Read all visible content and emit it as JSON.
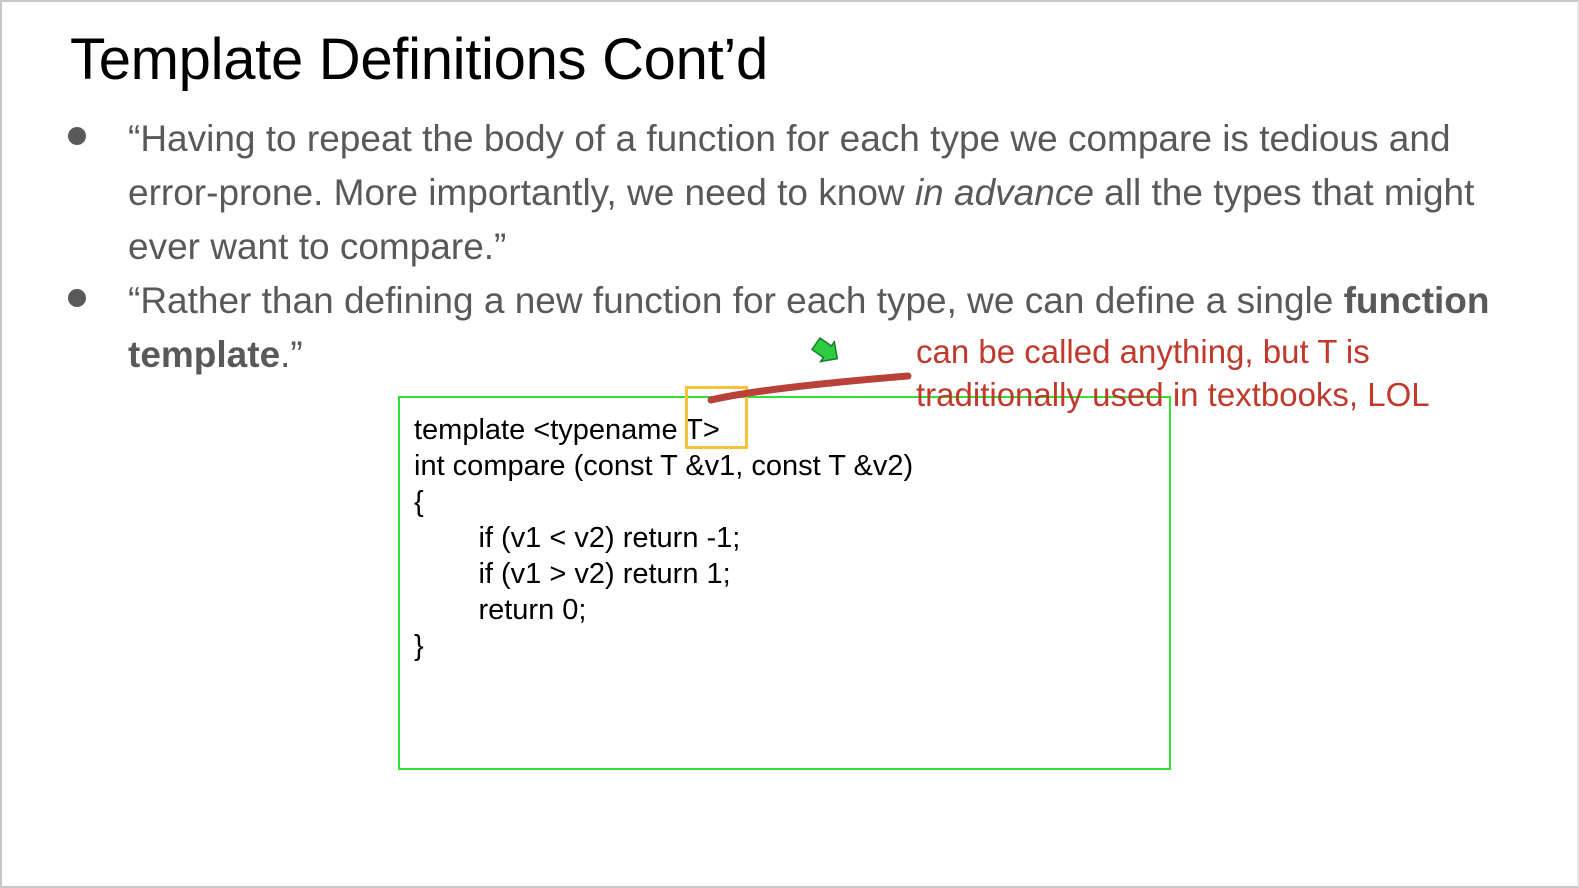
{
  "slide": {
    "title": "Template Definitions Cont’d",
    "bullets": [
      {
        "parts": [
          {
            "text": "“Having to repeat the body of a function for each type we compare is tedious and error-prone. More importantly, we need to know ",
            "style": "normal"
          },
          {
            "text": "in advance",
            "style": "italic"
          },
          {
            "text": " all the types that might ever want to compare.”",
            "style": "normal"
          }
        ]
      },
      {
        "parts": [
          {
            "text": "“Rather than defining a new function for each type, we can define a single ",
            "style": "normal"
          },
          {
            "text": "function template",
            "style": "bold"
          },
          {
            "text": ".”",
            "style": "normal"
          }
        ]
      }
    ],
    "code": [
      "template <typename T>",
      "int compare (const T &v1, const T &v2)",
      "{",
      "        if (v1 < v2) return -1;",
      "        if (v1 > v2) return 1;",
      "        return 0;",
      "}"
    ],
    "annotation": {
      "lines": [
        "can be called anything, but T is",
        "traditionally used in textbooks, LOL"
      ],
      "color": "#c0392b"
    }
  },
  "colors": {
    "title": "#000000",
    "body_text": "#595959",
    "code_box_border": "#33e033",
    "highlight_box": "#f7c23a",
    "annotation_stroke": "#b8413a",
    "cursor_arrow": "#2ecc40"
  },
  "icons": {
    "cursor": "green-arrow-cursor-icon"
  }
}
